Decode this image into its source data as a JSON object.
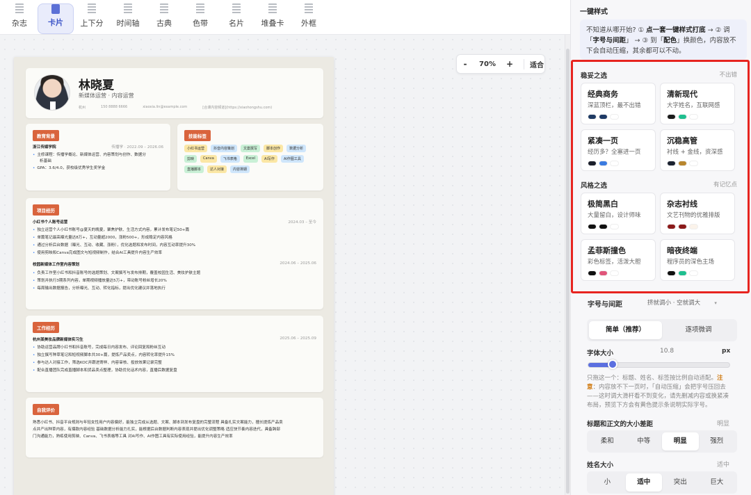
{
  "toolbar": {
    "templates": [
      {
        "label": "杂志",
        "active": false
      },
      {
        "label": "卡片",
        "active": true
      },
      {
        "label": "上下分",
        "active": false
      },
      {
        "label": "时间轴",
        "active": false
      },
      {
        "label": "古典",
        "active": false
      },
      {
        "label": "色带",
        "active": false
      },
      {
        "label": "名片",
        "active": false
      },
      {
        "label": "堆叠卡",
        "active": false
      },
      {
        "label": "外框",
        "active": false
      }
    ]
  },
  "zoom": {
    "minus": "-",
    "value": "70%",
    "plus": "+",
    "fit": "适合"
  },
  "resume": {
    "name": "林晓夏",
    "title": "新媒体运营 · 内容运营",
    "info": [
      "杭州",
      "150 8888 6666",
      "xiaoxia.lin@example.com",
      "[合课内容频道](https://xiaohongshu.com)"
    ],
    "education": {
      "tag": "教育背景",
      "school": "浙江传媒学院",
      "period": "传播学 · 2022.09 – 2026.06",
      "bullets": [
        "主修课程：传播学概论、新媒体运营、内容策划与创作、数据分",
        "析基础",
        "GPA：3.6/4.0，获校级优秀学生奖学金"
      ]
    },
    "skills": {
      "tag": "技能标签",
      "items": [
        {
          "label": "小红书运营",
          "color": "#fbe7a5"
        },
        {
          "label": "抖音内容策划",
          "color": "#cfe6fb"
        },
        {
          "label": "文案撰写",
          "color": "#c9f0d6"
        },
        {
          "label": "脚本创作",
          "color": "#fbe7a5"
        },
        {
          "label": "数据分析",
          "color": "#cfe6fb"
        },
        {
          "label": "剪映",
          "color": "#c9f0d6"
        },
        {
          "label": "Canva",
          "color": "#fbe7a5"
        },
        {
          "label": "飞书表格",
          "color": "#cfe6fb"
        },
        {
          "label": "Excel",
          "color": "#c9f0d6"
        },
        {
          "label": "AI写作",
          "color": "#fbe7a5"
        },
        {
          "label": "AI作图工具",
          "color": "#cfe6fb"
        },
        {
          "label": "直播脚本",
          "color": "#c9f0d6"
        },
        {
          "label": "达人对接",
          "color": "#fbe7a5"
        },
        {
          "label": "内容排期",
          "color": "#cfe6fb"
        }
      ]
    },
    "projects": {
      "tag": "项目经历",
      "p1_title": "小红书个人账号运营",
      "p1_period": "2024.03 – 至今",
      "p1_bullets": [
        "独立运营个人小红书账号@夏天的晚夏，聚焦护肤、生活方式内容，累计发布笔记50+篇",
        "单篇笔记最高曝光量达8万+，互动量超2000，涨粉500+，形成稳定内容风格",
        "通过分析后台数据（曝光、互动、收藏、涨粉），优化选题和发布时间，内容互动率提升30%",
        "使用剪映和Canva完成图文与短视频制作，结合AI工具提升内容生产效率"
      ],
      "p2_title": "校园新媒体工作室内容策划",
      "p2_period": "2024.06 – 2025.06",
      "p2_bullets": [
        "负责工作室小红书和抖音账号的选题策划、文案撰写与发布排期，覆盖校园生活、美妆护肤主题",
        "策划并执行3期系列内容，单期视频播放量达5万+，带动账号粉丝增长20%",
        "每周输出数据报告，分析曝光、互动、转化指标，提出优化建议并落地执行"
      ]
    },
    "work": {
      "tag": "工作经历",
      "company": "杭州某美妆品牌新媒体实习生",
      "period": "2025.06 – 2025.09",
      "bullets": [
        "协助运营品牌小红书和抖音账号，完成每日内容发布、评论回复和粉丝互动",
        "独立撰写种草笔记和短视频脚本共30+篇，提炼产品卖点，内容转化率提升15%",
        "参与达人对接工作，筛选KOC并跟进寄样、内容审核、投放效果记录完整",
        "配合直播团队完成直播脚本和货品卖点整理，协助优化话术内容，直播后数据复盘"
      ]
    },
    "self": {
      "tag": "自我评价",
      "lines": [
        "熟悉小红书、抖音平台规则与年轻女性用户内容偏好，能独立完成从选题、文案、脚本到发布复盘的完整流程 具备扎实文案能力，擅长提炼产品卖",
        "点并产出种草内容，有爆款内容经验 基础数据分析能力扎实，能根据后台数据判断内容表现并提出优化调整策略 适应快节奏内容迭代，具备跨部",
        "门沟通能力，熟练使用剪映、Canva、飞书表格等工具 对AI写作、AI作图工具有实际使用经验，能提升内容生产效率"
      ]
    }
  },
  "panel": {
    "title": "一键样式",
    "hint_pre": "不知道从哪开始? ① ",
    "hint_b1": "点一套一键样式打底",
    "hint_m1": " → ② 调「",
    "hint_b2": "字号与间距",
    "hint_m2": "」 → ③ 到「",
    "hint_b3": "配色",
    "hint_m3": "」换颜色，内容放不下会自动压缩，其余都可以不动。",
    "group1": {
      "label": "稳妥之选",
      "right": "不出错"
    },
    "group2": {
      "label": "风格之选",
      "right": "有记忆点"
    },
    "styles": [
      {
        "title": "经典商务",
        "desc": "深蓝顶栏，最不出错",
        "colors": [
          "#1f3b63",
          "#1e3a66",
          "#ffffff"
        ]
      },
      {
        "title": "清新现代",
        "desc": "大字姓名，互联网感",
        "colors": [
          "#1b1b1b",
          "#1fbf8f",
          "#ffffff"
        ]
      },
      {
        "title": "紧凑一页",
        "desc": "经历多？全塞进一页",
        "colors": [
          "#1b1f2b",
          "#3b7be0",
          "#ffffff"
        ]
      },
      {
        "title": "沉稳高管",
        "desc": "衬线 + 金线，资深感",
        "colors": [
          "#1b2230",
          "#b8862e",
          "#ffffff"
        ]
      },
      {
        "title": "极简黑白",
        "desc": "大量留白，设计师味",
        "colors": [
          "#111111",
          "#111111",
          "#ffffff"
        ]
      },
      {
        "title": "杂志衬线",
        "desc": "文艺刊物的优雅排版",
        "colors": [
          "#8b1a1a",
          "#8b1a1a",
          "#fbf3ea"
        ]
      },
      {
        "title": "孟菲斯撞色",
        "desc": "彩色标签，活泼大胆",
        "colors": [
          "#111111",
          "#e0557a",
          "#ffffff"
        ]
      },
      {
        "title": "暗夜终端",
        "desc": "程序员的深色主场",
        "colors": [
          "#111111",
          "#1fbf8f",
          "#ffffff"
        ]
      }
    ],
    "font_section": {
      "label": "字号与间距",
      "right": "挤就调小 · 空就调大"
    },
    "mode": [
      "简单（推荐）",
      "逐项微调"
    ],
    "font_size": {
      "label": "字体大小",
      "value": "10.8",
      "unit": "px",
      "level": 0.17
    },
    "note_pre": "只拖这一个：标题、姓名、标签按比例自动适配。",
    "note_b": "注意",
    "note_post": "：内容放不下一页时，「自动压缩」会把字号压回去——这时调大滑杆看不到变化，请先删减内容或换紧凑布局，预览下方会有黄色提示条说明实际字号。",
    "contrast": {
      "label": "标题和正文的大小差距",
      "right": "明显",
      "options": [
        "柔和",
        "中等",
        "明显",
        "强烈"
      ],
      "selected": 2
    },
    "name_size": {
      "label": "姓名大小",
      "right": "适中",
      "options": [
        "小",
        "适中",
        "突出",
        "巨大"
      ],
      "selected": 1
    }
  }
}
